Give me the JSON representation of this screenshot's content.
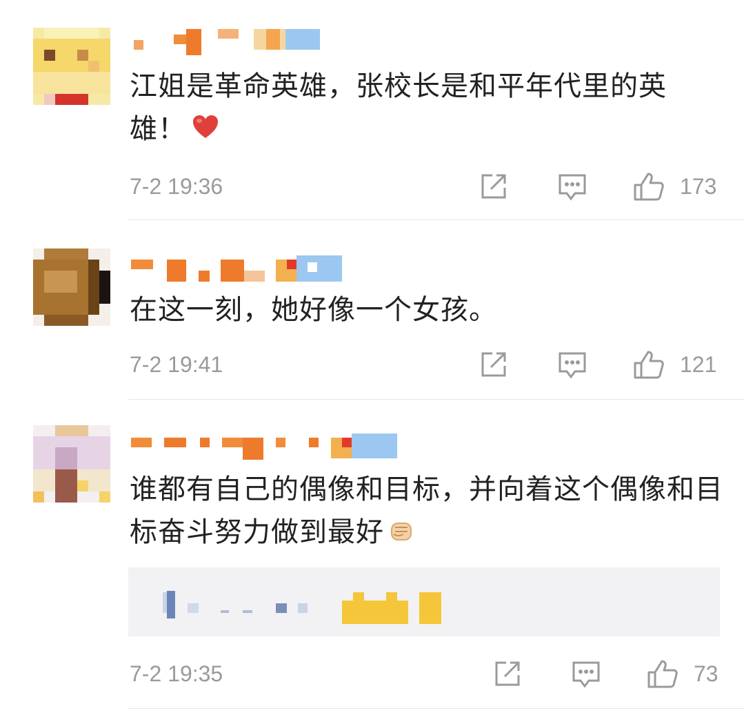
{
  "comments": [
    {
      "text": "江姐是革命英雄，张校长是和平年代里的英雄！",
      "emoji": "heart-emoji",
      "time": "7-2 19:36",
      "likes": "173"
    },
    {
      "text": "在这一刻，她好像一个女孩。",
      "time": "7-2 19:41",
      "likes": "121"
    },
    {
      "text": "谁都有自己的偶像和目标，并向着这个偶像和目标奋斗努力做到最好",
      "emoji": "fist-emoji",
      "time": "7-2 19:35",
      "likes": "73"
    }
  ],
  "icons": {
    "repost": "repost-icon",
    "comment": "comment-icon",
    "like": "thumbs-up-icon"
  },
  "colors": {
    "text": "#222222",
    "meta": "#9a9a9a",
    "divider": "#e6e6e6",
    "reply_bg": "#f2f2f4",
    "heart": "#e0403a"
  }
}
